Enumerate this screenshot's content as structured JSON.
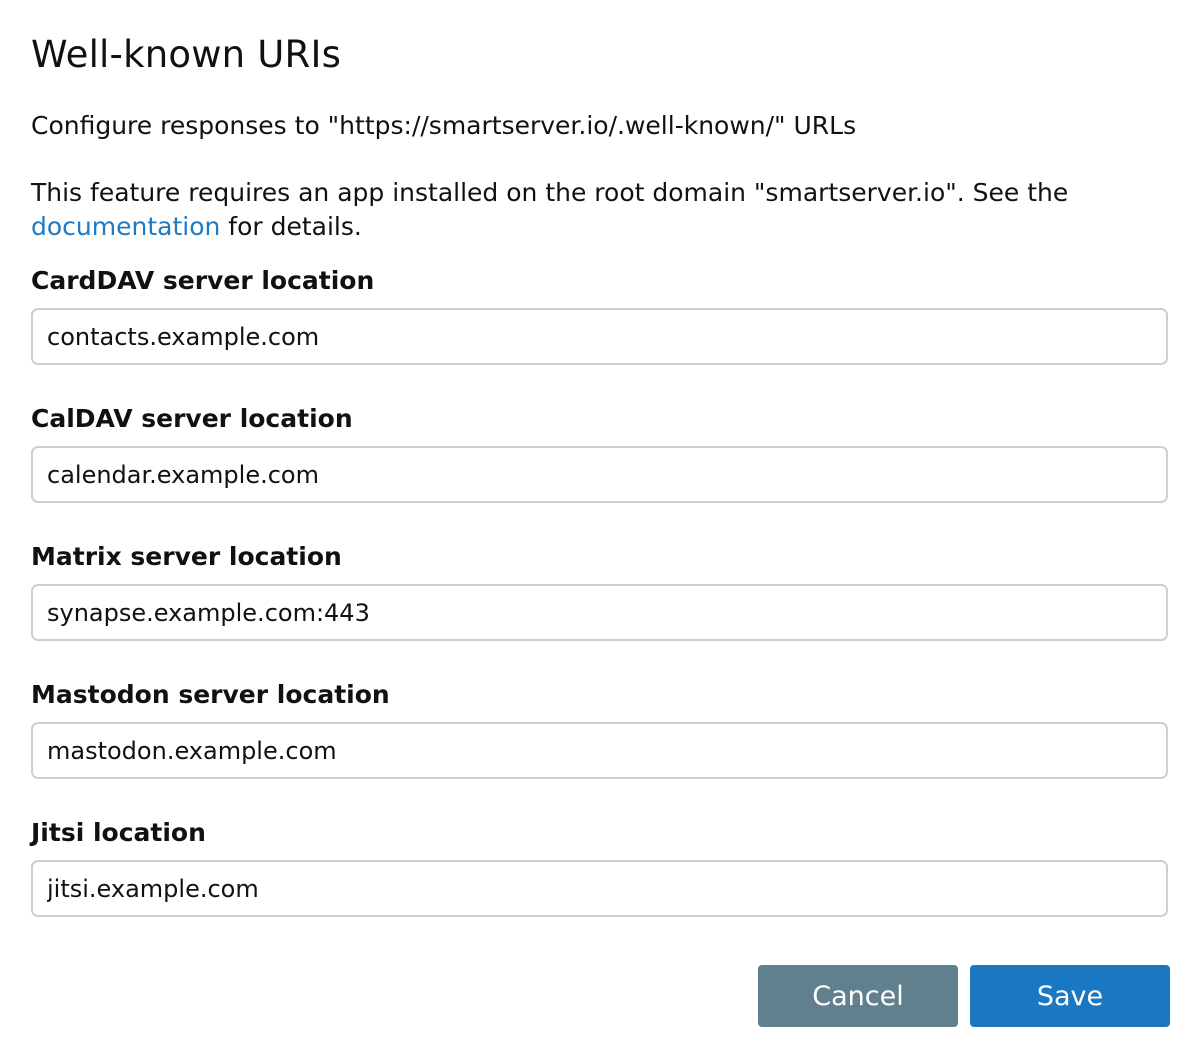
{
  "dialog": {
    "title": "Well-known URIs",
    "subtitle": "Configure responses to \"https://smartserver.io/.well-known/\" URLs",
    "note_prefix": "This feature requires an app installed on the root domain \"smartserver.io\". See the ",
    "note_link": "documentation",
    "note_suffix": " for details."
  },
  "fields": [
    {
      "label": "CardDAV server location",
      "value": "contacts.example.com"
    },
    {
      "label": "CalDAV server location",
      "value": "calendar.example.com"
    },
    {
      "label": "Matrix server location",
      "value": "synapse.example.com:443"
    },
    {
      "label": "Mastodon server location",
      "value": "mastodon.example.com"
    },
    {
      "label": "Jitsi location",
      "value": "jitsi.example.com"
    }
  ],
  "buttons": {
    "cancel": "Cancel",
    "save": "Save"
  },
  "colors": {
    "link": "#1f7ac4",
    "cancel_bg": "#61808e",
    "save_bg": "#1a78c2",
    "input_border": "#cfcfcf"
  }
}
